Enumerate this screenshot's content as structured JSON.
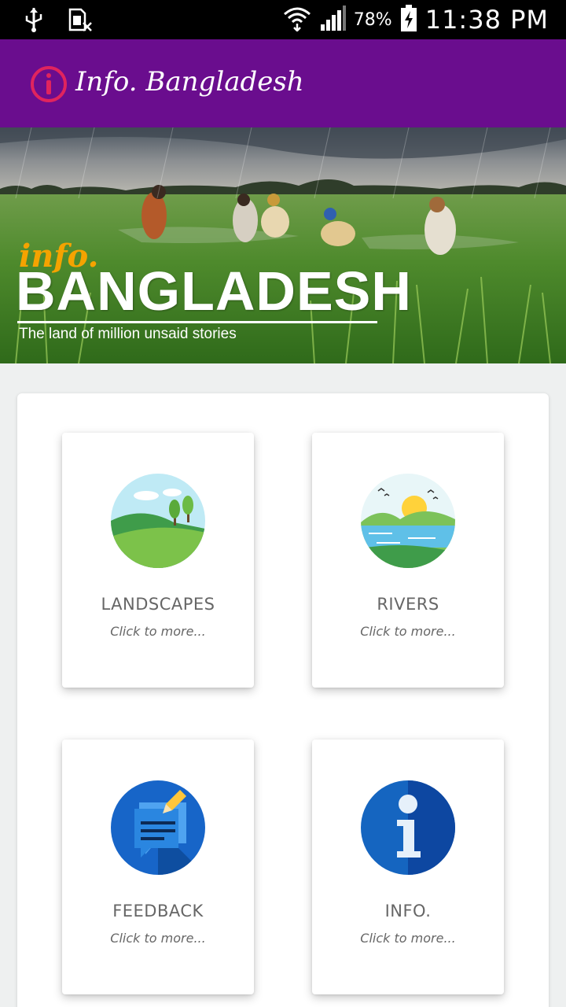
{
  "status_bar": {
    "battery": "78%",
    "time": "11:38 PM",
    "icons": [
      "usb-icon",
      "sim-off-icon",
      "wifi-icon",
      "signal-icon",
      "battery-charging-icon"
    ]
  },
  "app_bar": {
    "title": "Info. Bangladesh",
    "icon": "info-circle-icon"
  },
  "banner": {
    "kicker": "info.",
    "title": "BANGLADESH",
    "tagline": "The land of million unsaid stories"
  },
  "tiles": [
    {
      "title": "LANDSCAPES",
      "subtitle": "Click to more...",
      "icon": "landscape-icon"
    },
    {
      "title": "RIVERS",
      "subtitle": "Click to more...",
      "icon": "river-icon"
    },
    {
      "title": "FEEDBACK",
      "subtitle": "Click to more...",
      "icon": "feedback-icon"
    },
    {
      "title": "INFO.",
      "subtitle": "Click to more...",
      "icon": "info-icon"
    }
  ],
  "colors": {
    "app_bar": "#6a0d8e",
    "status_bar": "#000000",
    "accent_icon": "#e0245e",
    "banner_kicker": "#f5a300"
  }
}
